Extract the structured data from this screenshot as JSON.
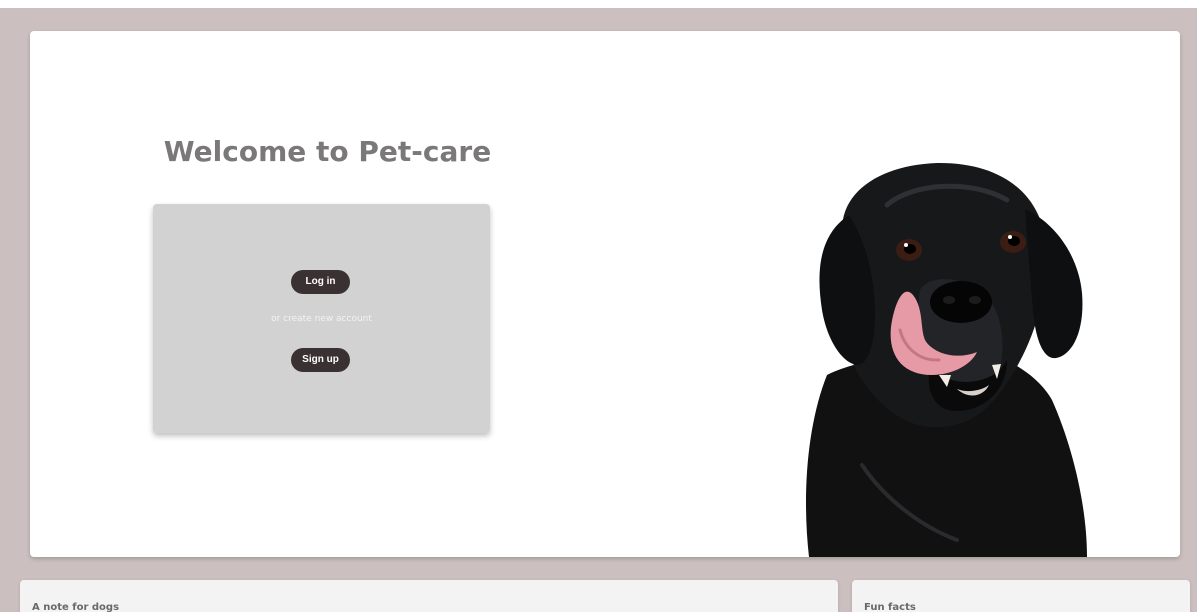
{
  "hero": {
    "title": "Welcome to Pet-care"
  },
  "auth": {
    "login_label": "Log in",
    "or_text": "or create new account",
    "signup_label": "Sign up"
  },
  "sections": {
    "note_heading": "A note for dogs",
    "facts_heading": "Fun facts"
  },
  "colors": {
    "background": "#cbc0bf",
    "button": "#3a3132",
    "panel": "#d3d2d2"
  },
  "icons": {
    "hero_image": "black-labrador-dog"
  }
}
